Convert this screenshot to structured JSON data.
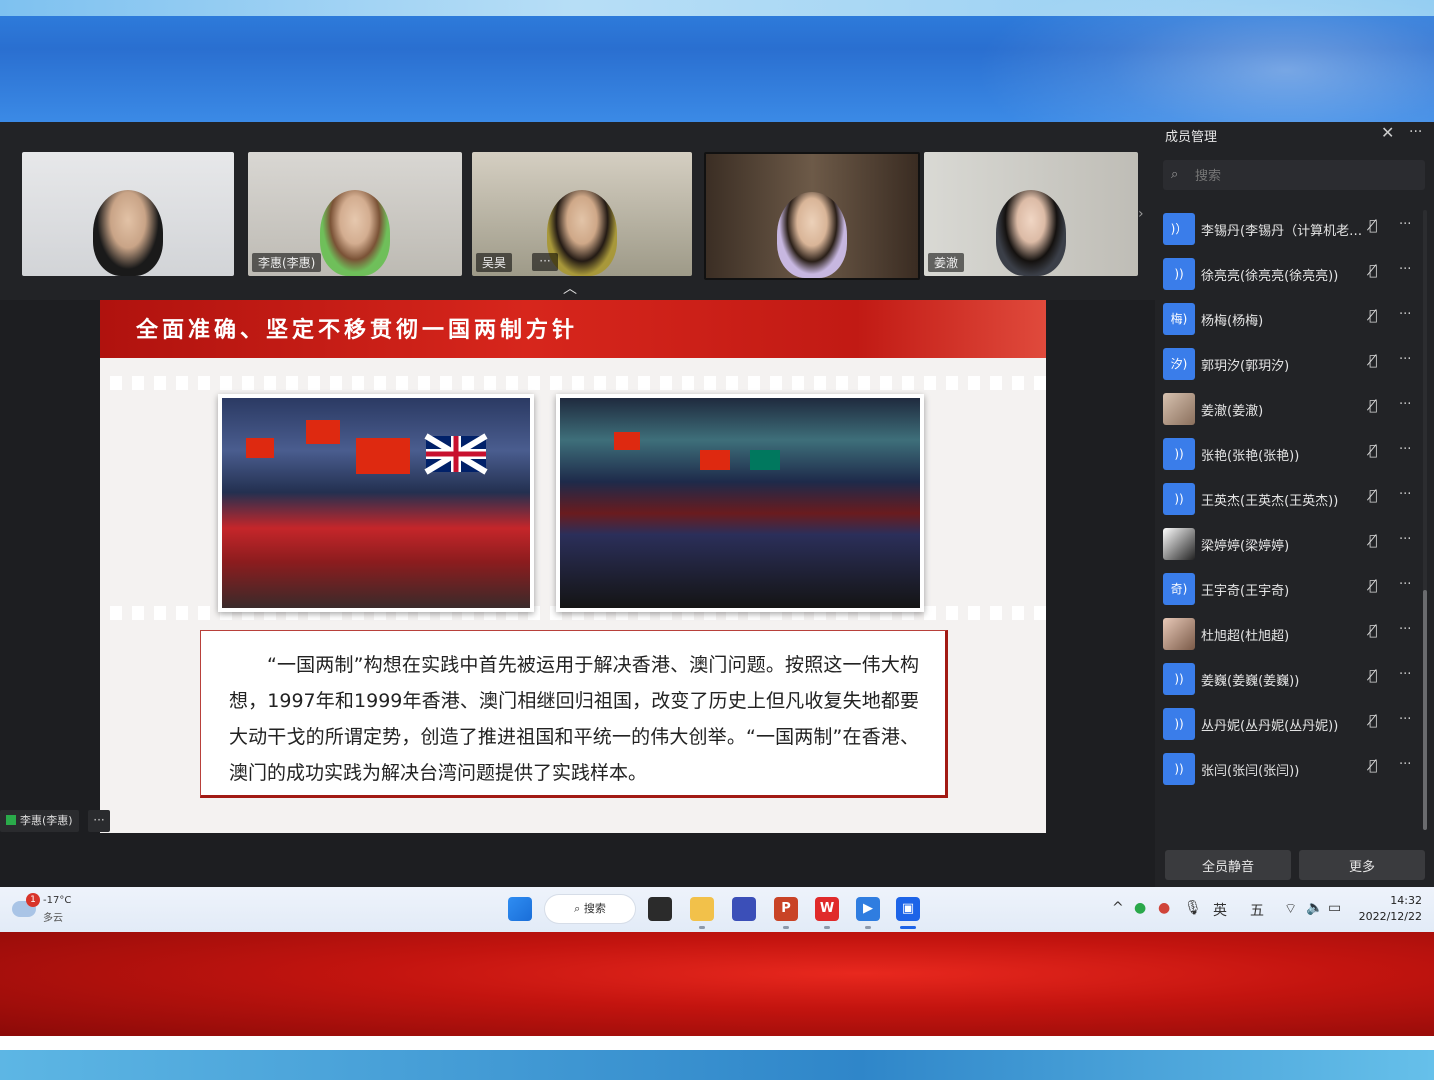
{
  "thumbnails": [
    {
      "name": ""
    },
    {
      "name": "李惠(李惠)"
    },
    {
      "name": "吴昊"
    },
    {
      "name": ""
    },
    {
      "name": "姜澈"
    }
  ],
  "thumb_more": "···",
  "slide": {
    "title": "全面准确、坚定不移贯彻一国两制方针",
    "paragraph": "“一国两制”构想在实践中首先被运用于解决香港、澳门问题。按照这一伟大构想，1997年和1999年香港、澳门相继回归祖国，改变了历史上但凡收复失地都要大动干戈的所谓定势，创造了推进祖国和平统一的伟大创举。“一国两制”在香港、澳门的成功实践为解决台湾问题提供了实践样本。"
  },
  "speaker": {
    "name": "李惠(李惠)",
    "more": "···"
  },
  "panel": {
    "title": "成员管理",
    "close": "✕",
    "more": "···",
    "search_placeholder": "搜索",
    "members": [
      {
        "avatar": ")）",
        "name": "李锡丹(李锡丹（计算机老师...",
        "avatar_type": "text"
      },
      {
        "avatar": "))",
        "name": "徐亮亮(徐亮亮(徐亮亮))",
        "avatar_type": "text"
      },
      {
        "avatar": "梅)",
        "name": "杨梅(杨梅)",
        "avatar_type": "text"
      },
      {
        "avatar": "汐)",
        "name": "郭玥汐(郭玥汐)",
        "avatar_type": "text"
      },
      {
        "avatar": "",
        "name": "姜澈(姜澈)",
        "avatar_type": "photo"
      },
      {
        "avatar": "))",
        "name": "张艳(张艳(张艳))",
        "avatar_type": "text"
      },
      {
        "avatar": "))",
        "name": "王英杰(王英杰(王英杰))",
        "avatar_type": "text"
      },
      {
        "avatar": "",
        "name": "梁婷婷(梁婷婷)",
        "avatar_type": "photo"
      },
      {
        "avatar": "奇)",
        "name": "王宇奇(王宇奇)",
        "avatar_type": "text"
      },
      {
        "avatar": "",
        "name": "杜旭超(杜旭超)",
        "avatar_type": "photo"
      },
      {
        "avatar": "))",
        "name": "姜巍(姜巍(姜巍))",
        "avatar_type": "text"
      },
      {
        "avatar": "))",
        "name": "丛丹妮(丛丹妮(丛丹妮))",
        "avatar_type": "text"
      },
      {
        "avatar": "))",
        "name": "张闫(张闫(张闫))",
        "avatar_type": "text"
      }
    ],
    "mute_all": "全员静音",
    "more_button": "更多"
  },
  "taskbar": {
    "weather_badge": "1",
    "temperature": "-17°C",
    "condition": "多云",
    "search": "搜索",
    "ime1": "英",
    "ime2": "五",
    "time": "14:32",
    "date": "2022/12/22"
  },
  "colors": {
    "accent_blue": "#3a7dea",
    "slide_red": "#c11a14",
    "panel_bg": "#222326"
  }
}
